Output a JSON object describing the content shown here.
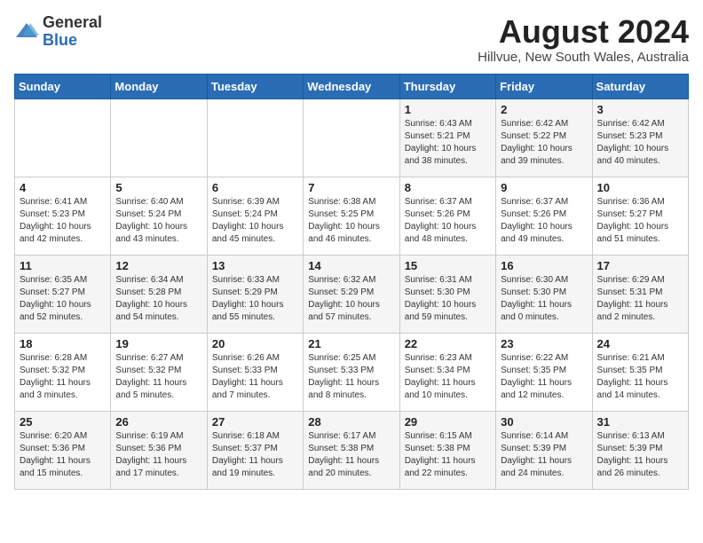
{
  "header": {
    "logo_line1": "General",
    "logo_line2": "Blue",
    "month_title": "August 2024",
    "location": "Hillvue, New South Wales, Australia"
  },
  "days_of_week": [
    "Sunday",
    "Monday",
    "Tuesday",
    "Wednesday",
    "Thursday",
    "Friday",
    "Saturday"
  ],
  "weeks": [
    [
      {
        "day": "",
        "info": ""
      },
      {
        "day": "",
        "info": ""
      },
      {
        "day": "",
        "info": ""
      },
      {
        "day": "",
        "info": ""
      },
      {
        "day": "1",
        "info": "Sunrise: 6:43 AM\nSunset: 5:21 PM\nDaylight: 10 hours\nand 38 minutes."
      },
      {
        "day": "2",
        "info": "Sunrise: 6:42 AM\nSunset: 5:22 PM\nDaylight: 10 hours\nand 39 minutes."
      },
      {
        "day": "3",
        "info": "Sunrise: 6:42 AM\nSunset: 5:23 PM\nDaylight: 10 hours\nand 40 minutes."
      }
    ],
    [
      {
        "day": "4",
        "info": "Sunrise: 6:41 AM\nSunset: 5:23 PM\nDaylight: 10 hours\nand 42 minutes."
      },
      {
        "day": "5",
        "info": "Sunrise: 6:40 AM\nSunset: 5:24 PM\nDaylight: 10 hours\nand 43 minutes."
      },
      {
        "day": "6",
        "info": "Sunrise: 6:39 AM\nSunset: 5:24 PM\nDaylight: 10 hours\nand 45 minutes."
      },
      {
        "day": "7",
        "info": "Sunrise: 6:38 AM\nSunset: 5:25 PM\nDaylight: 10 hours\nand 46 minutes."
      },
      {
        "day": "8",
        "info": "Sunrise: 6:37 AM\nSunset: 5:26 PM\nDaylight: 10 hours\nand 48 minutes."
      },
      {
        "day": "9",
        "info": "Sunrise: 6:37 AM\nSunset: 5:26 PM\nDaylight: 10 hours\nand 49 minutes."
      },
      {
        "day": "10",
        "info": "Sunrise: 6:36 AM\nSunset: 5:27 PM\nDaylight: 10 hours\nand 51 minutes."
      }
    ],
    [
      {
        "day": "11",
        "info": "Sunrise: 6:35 AM\nSunset: 5:27 PM\nDaylight: 10 hours\nand 52 minutes."
      },
      {
        "day": "12",
        "info": "Sunrise: 6:34 AM\nSunset: 5:28 PM\nDaylight: 10 hours\nand 54 minutes."
      },
      {
        "day": "13",
        "info": "Sunrise: 6:33 AM\nSunset: 5:29 PM\nDaylight: 10 hours\nand 55 minutes."
      },
      {
        "day": "14",
        "info": "Sunrise: 6:32 AM\nSunset: 5:29 PM\nDaylight: 10 hours\nand 57 minutes."
      },
      {
        "day": "15",
        "info": "Sunrise: 6:31 AM\nSunset: 5:30 PM\nDaylight: 10 hours\nand 59 minutes."
      },
      {
        "day": "16",
        "info": "Sunrise: 6:30 AM\nSunset: 5:30 PM\nDaylight: 11 hours\nand 0 minutes."
      },
      {
        "day": "17",
        "info": "Sunrise: 6:29 AM\nSunset: 5:31 PM\nDaylight: 11 hours\nand 2 minutes."
      }
    ],
    [
      {
        "day": "18",
        "info": "Sunrise: 6:28 AM\nSunset: 5:32 PM\nDaylight: 11 hours\nand 3 minutes."
      },
      {
        "day": "19",
        "info": "Sunrise: 6:27 AM\nSunset: 5:32 PM\nDaylight: 11 hours\nand 5 minutes."
      },
      {
        "day": "20",
        "info": "Sunrise: 6:26 AM\nSunset: 5:33 PM\nDaylight: 11 hours\nand 7 minutes."
      },
      {
        "day": "21",
        "info": "Sunrise: 6:25 AM\nSunset: 5:33 PM\nDaylight: 11 hours\nand 8 minutes."
      },
      {
        "day": "22",
        "info": "Sunrise: 6:23 AM\nSunset: 5:34 PM\nDaylight: 11 hours\nand 10 minutes."
      },
      {
        "day": "23",
        "info": "Sunrise: 6:22 AM\nSunset: 5:35 PM\nDaylight: 11 hours\nand 12 minutes."
      },
      {
        "day": "24",
        "info": "Sunrise: 6:21 AM\nSunset: 5:35 PM\nDaylight: 11 hours\nand 14 minutes."
      }
    ],
    [
      {
        "day": "25",
        "info": "Sunrise: 6:20 AM\nSunset: 5:36 PM\nDaylight: 11 hours\nand 15 minutes."
      },
      {
        "day": "26",
        "info": "Sunrise: 6:19 AM\nSunset: 5:36 PM\nDaylight: 11 hours\nand 17 minutes."
      },
      {
        "day": "27",
        "info": "Sunrise: 6:18 AM\nSunset: 5:37 PM\nDaylight: 11 hours\nand 19 minutes."
      },
      {
        "day": "28",
        "info": "Sunrise: 6:17 AM\nSunset: 5:38 PM\nDaylight: 11 hours\nand 20 minutes."
      },
      {
        "day": "29",
        "info": "Sunrise: 6:15 AM\nSunset: 5:38 PM\nDaylight: 11 hours\nand 22 minutes."
      },
      {
        "day": "30",
        "info": "Sunrise: 6:14 AM\nSunset: 5:39 PM\nDaylight: 11 hours\nand 24 minutes."
      },
      {
        "day": "31",
        "info": "Sunrise: 6:13 AM\nSunset: 5:39 PM\nDaylight: 11 hours\nand 26 minutes."
      }
    ]
  ]
}
